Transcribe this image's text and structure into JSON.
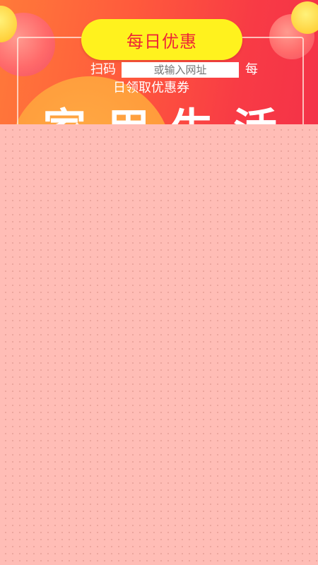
{
  "banner": {
    "title": "每日优惠",
    "scan_prefix": "扫码",
    "url_placeholder": "或输入网址",
    "scan_suffix": "每",
    "subtitle": "日领取优惠券",
    "headline_partial": "家用生活"
  },
  "colors": {
    "title_pill": "#fff21e",
    "title_text": "#ee2436",
    "banner_gradient_start": "#ff7a3a",
    "banner_gradient_end": "#f43248",
    "overlay": "#ffbdb6",
    "url_text": "#e0245a"
  }
}
